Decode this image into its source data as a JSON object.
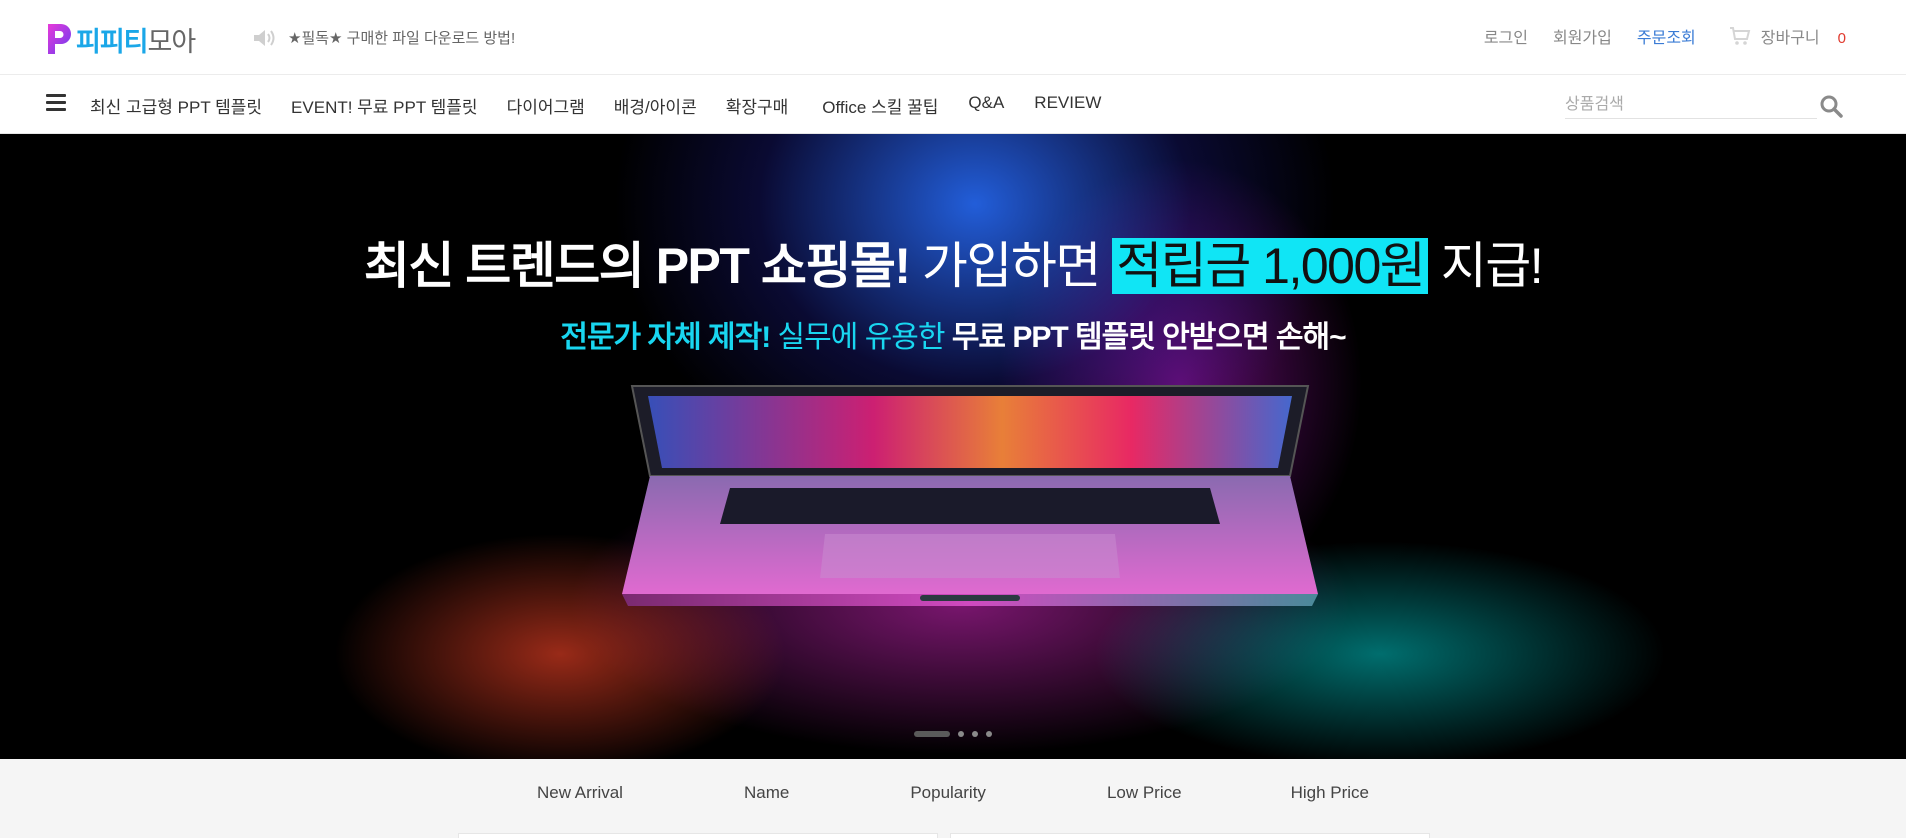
{
  "header": {
    "logo_text_a": "피피티",
    "logo_text_b": "모아",
    "notice": "★필독★ 구매한 파일 다운로드 방법!",
    "login": "로그인",
    "signup": "회원가입",
    "order_lookup": "주문조회",
    "cart_label": "장바구니",
    "cart_count": "0"
  },
  "nav": {
    "items": [
      "최신 고급형 PPT 템플릿",
      "EVENT! 무료 PPT 템플릿",
      "다이어그램",
      "배경/아이콘",
      "확장구매",
      "Office 스킬 꿀팁",
      "Q&A",
      "REVIEW"
    ],
    "search_placeholder": "상품검색"
  },
  "hero": {
    "line1_bold": "최신 트렌드의 PPT 쇼핑몰!",
    "line1_normal": " 가입하면 ",
    "line1_highlight": "적립금 1,000원",
    "line1_end": " 지급!",
    "line2_a": "전문가 자체 제작!",
    "line2_b": " 실무에 유용한 ",
    "line2_c": "무료 PPT 템플릿 안받으면 손해~",
    "slide_count": 4,
    "active_slide": 1
  },
  "sort": {
    "options": [
      "New Arrival",
      "Name",
      "Popularity",
      "Low Price",
      "High Price"
    ]
  },
  "colors": {
    "accent_blue": "#1aa7e8",
    "order_link": "#3a7bd5",
    "cart_count": "#e03a2e",
    "hero_highlight": "#10e5f5",
    "hero_cyan": "#19d6f0"
  },
  "icons": {
    "logo": "p-logo-icon",
    "notice": "speaker-icon",
    "cart": "cart-icon",
    "menu": "hamburger-icon",
    "search": "search-icon"
  }
}
